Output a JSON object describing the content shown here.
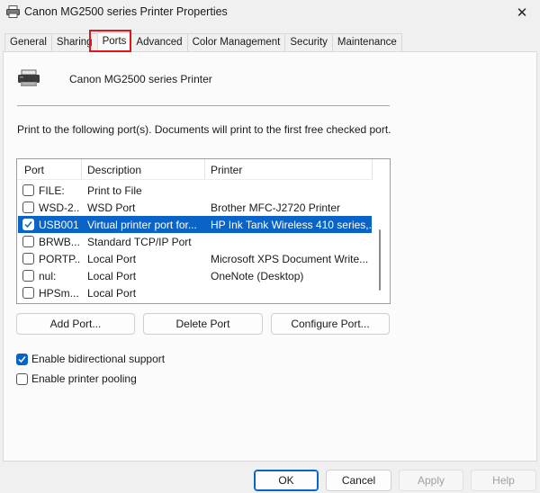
{
  "window": {
    "title": "Canon MG2500 series Printer Properties"
  },
  "tabs": [
    {
      "label": "General",
      "active": false
    },
    {
      "label": "Sharing",
      "active": false
    },
    {
      "label": "Ports",
      "active": true
    },
    {
      "label": "Advanced",
      "active": false
    },
    {
      "label": "Color Management",
      "active": false
    },
    {
      "label": "Security",
      "active": false
    },
    {
      "label": "Maintenance",
      "active": false
    }
  ],
  "printer": {
    "name": "Canon MG2500 series Printer"
  },
  "description": "Print to the following port(s). Documents will print to the first free checked port.",
  "port_table": {
    "headers": [
      "Port",
      "Description",
      "Printer"
    ],
    "rows": [
      {
        "checked": false,
        "selected": false,
        "port": "FILE:",
        "description": "Print to File",
        "printer": ""
      },
      {
        "checked": false,
        "selected": false,
        "port": "WSD-2...",
        "description": "WSD Port",
        "printer": "Brother MFC-J2720 Printer"
      },
      {
        "checked": true,
        "selected": true,
        "port": "USB001",
        "description": "Virtual printer port for...",
        "printer": "HP Ink Tank Wireless 410 series,..."
      },
      {
        "checked": false,
        "selected": false,
        "port": "BRWB...",
        "description": "Standard TCP/IP Port",
        "printer": ""
      },
      {
        "checked": false,
        "selected": false,
        "port": "PORTP...",
        "description": "Local Port",
        "printer": "Microsoft XPS Document Write..."
      },
      {
        "checked": false,
        "selected": false,
        "port": "nul:",
        "description": "Local Port",
        "printer": "OneNote (Desktop)"
      },
      {
        "checked": false,
        "selected": false,
        "port": "HPSm...",
        "description": "Local Port",
        "printer": ""
      }
    ]
  },
  "port_buttons": {
    "add": "Add Port...",
    "delete": "Delete Port",
    "configure": "Configure Port..."
  },
  "options": {
    "bidirectional": {
      "label": "Enable bidirectional support",
      "checked": true
    },
    "pooling": {
      "label": "Enable printer pooling",
      "checked": false
    }
  },
  "dialog_buttons": {
    "ok": "OK",
    "cancel": "Cancel",
    "apply": "Apply",
    "help": "Help"
  },
  "colors": {
    "accent": "#0a64c8",
    "tab_highlight": "#e0161b"
  }
}
